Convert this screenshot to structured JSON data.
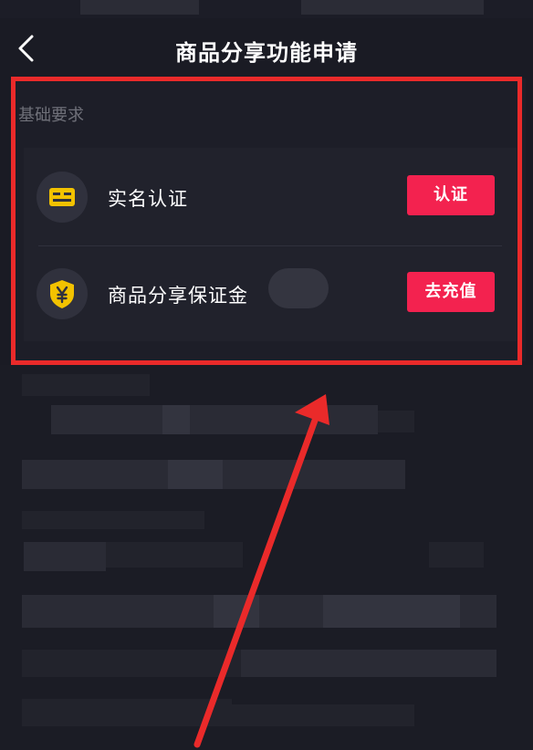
{
  "header": {
    "title": "商品分享功能申请"
  },
  "section": {
    "label": "基础要求",
    "items": [
      {
        "label": "实名认证",
        "icon": "id-card-icon",
        "button": "认证"
      },
      {
        "label": "商品分享保证金",
        "icon": "yuan-shield-icon",
        "button": "去充值"
      }
    ]
  },
  "colors": {
    "background": "#1a1b24",
    "accent": "#f3224f",
    "highlight_border": "#ea2a2a",
    "icon_gold": "#f2c200"
  }
}
